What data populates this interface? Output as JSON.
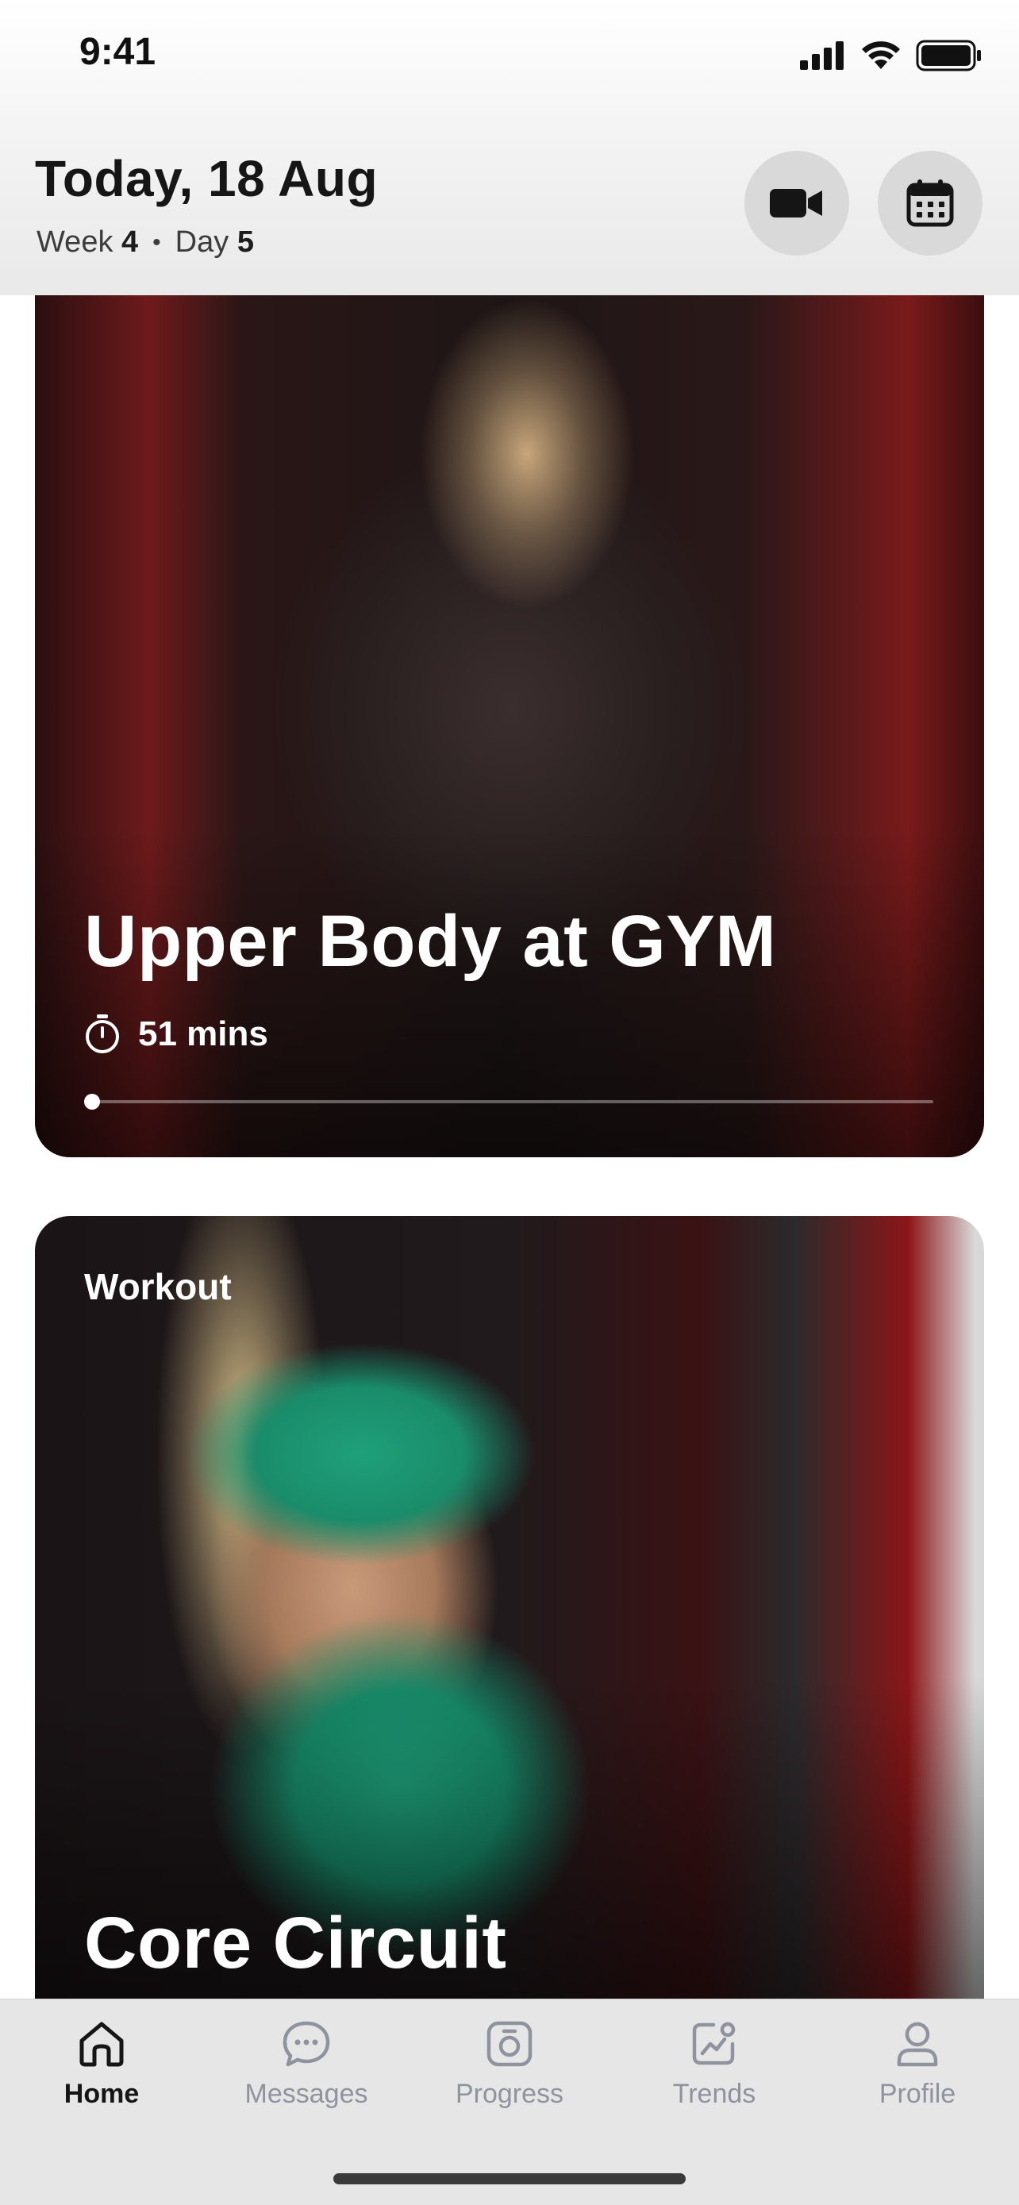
{
  "status_bar": {
    "time": "9:41"
  },
  "header": {
    "title": "Today, 18 Aug",
    "week_label": "Week",
    "week_value": "4",
    "separator": "•",
    "day_label": "Day",
    "day_value": "5",
    "video_icon": "video-camera-icon",
    "calendar_icon": "calendar-icon"
  },
  "cards": [
    {
      "title": "Upper Body at GYM",
      "duration": "51 mins",
      "progress": 0.0,
      "colors": {
        "accent": "#ffffff"
      }
    },
    {
      "tag": "Workout",
      "title": "Core Circuit"
    }
  ],
  "tab_bar": {
    "items": [
      {
        "label": "Home",
        "icon": "home-icon",
        "active": true
      },
      {
        "label": "Messages",
        "icon": "chat-bubble-icon",
        "active": false
      },
      {
        "label": "Progress",
        "icon": "scale-icon",
        "active": false
      },
      {
        "label": "Trends",
        "icon": "trend-chart-icon",
        "active": false
      },
      {
        "label": "Profile",
        "icon": "person-icon",
        "active": false
      }
    ]
  },
  "colors": {
    "tab_active": "#151515",
    "tab_inactive": "#8e939e",
    "header_button_bg": "#d9d9d9"
  }
}
